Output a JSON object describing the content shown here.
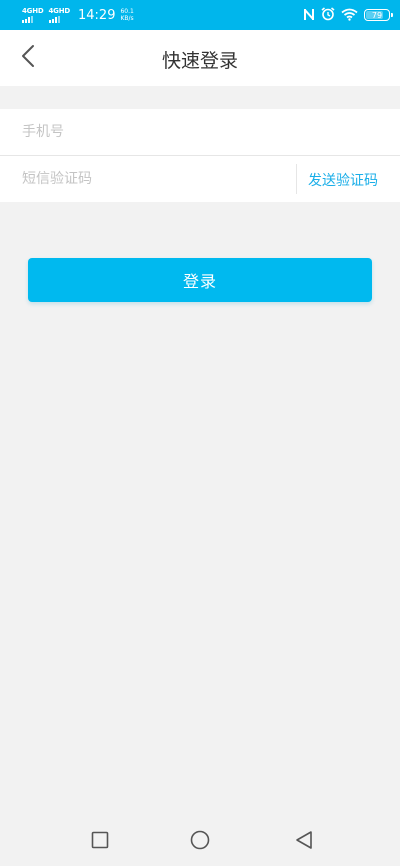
{
  "status_bar": {
    "signal1_label": "4GHD",
    "signal2_label": "4GHD",
    "time": "14:29",
    "netspeed_value": "60.1",
    "netspeed_unit": "KB/s",
    "battery": "79",
    "battery_level": 0.79,
    "icons": [
      "nfc-icon",
      "alarm-icon",
      "wifi-icon",
      "battery-icon"
    ]
  },
  "header": {
    "title": "快速登录",
    "back_icon": "chevron-left-icon"
  },
  "form": {
    "phone_placeholder": "手机号",
    "code_placeholder": "短信验证码",
    "send_code_label": "发送验证码"
  },
  "login_button_label": "登录",
  "nav_bar": {
    "icons": [
      "recent-apps-icon",
      "home-icon",
      "back-icon"
    ]
  },
  "colors": {
    "accent": "#00b9ef",
    "link": "#1aaee8",
    "background": "#f2f2f2"
  }
}
